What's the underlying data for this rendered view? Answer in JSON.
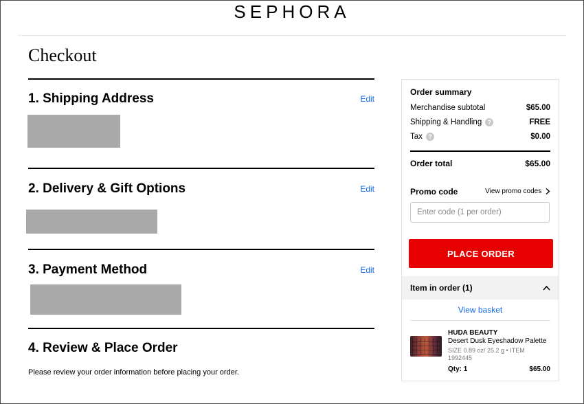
{
  "brand_logo": "SEPHORA",
  "page_title": "Checkout",
  "sections": [
    {
      "title": "1. Shipping Address",
      "edit": "Edit"
    },
    {
      "title": "2. Delivery & Gift Options",
      "edit": "Edit"
    },
    {
      "title": "3. Payment Method",
      "edit": "Edit"
    },
    {
      "title": "4. Review & Place Order"
    }
  ],
  "review_note": "Please review your order information before placing your order.",
  "summary": {
    "title": "Order summary",
    "rows": [
      {
        "label": "Merchandise subtotal",
        "value": "$65.00"
      },
      {
        "label": "Shipping & Handling",
        "value": "FREE"
      },
      {
        "label": "Tax",
        "value": "$0.00"
      }
    ],
    "help_glyph": "?",
    "total_label": "Order total",
    "total_value": "$65.00",
    "promo_label": "Promo code",
    "promo_link": "View promo codes",
    "promo_placeholder": "Enter code (1 per order)",
    "place_order": "PLACE ORDER",
    "items_header": "Item in order (1)",
    "view_basket": "View basket"
  },
  "item": {
    "brand": "HUDA BEAUTY",
    "name": "Desert Dusk Eyeshadow Palette",
    "size": "SIZE 0.89 oz/ 25.2 g • ITEM 1992445",
    "qty": "Qty: 1",
    "price": "$65.00"
  },
  "colors": {
    "accent_red": "#e60000",
    "link_blue": "#136bea",
    "redaction_gray": "#a9a9a9"
  },
  "icons": {
    "help": "question-circle-icon",
    "chevron_right": "chevron-right-icon",
    "chevron_up": "chevron-up-icon"
  }
}
